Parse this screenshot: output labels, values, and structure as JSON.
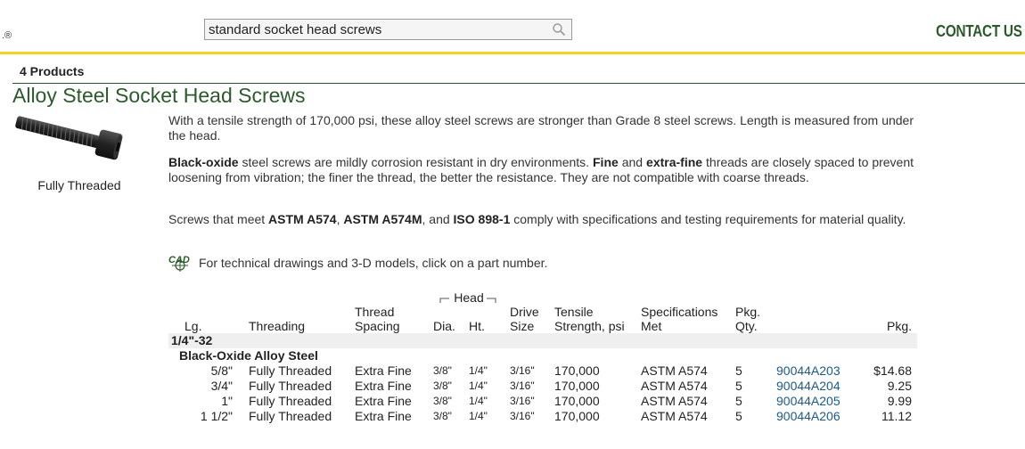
{
  "header": {
    "logo_mark": ".®",
    "search_value": "standard socket head screws",
    "contact_label": "CONTACT US"
  },
  "results": {
    "count": "4 Products",
    "title": "Alloy Steel Socket Head Screws",
    "thumb_label": "Fully Threaded",
    "para1": "With a tensile strength of 170,000 psi, these alloy steel screws are stronger than Grade 8 steel screws. Length is measured from under the head.",
    "para2": {
      "b1": "Black-oxide",
      "t1": " steel screws are mildly corrosion resistant in dry environments. ",
      "b2": "Fine",
      "t2": " and ",
      "b3": "extra-fine",
      "t3": " threads are closely spaced to prevent loosening from vibration; the finer the thread, the better the resistance. They are not compatible with coarse threads."
    },
    "para3": {
      "t1": "Screws that meet ",
      "b1": "ASTM A574",
      "t2": ", ",
      "b2": "ASTM A574M",
      "t3": ", and ",
      "b3": "ISO 898-1",
      "t4": " comply with specifications and testing requirements for material quality."
    },
    "cad_text": "For technical drawings and 3-D models, click on a part number."
  },
  "table": {
    "head_group": "Head",
    "columns": {
      "lg": "Lg.",
      "threading": "Threading",
      "spacing": "Thread Spacing",
      "dia": "Dia.",
      "ht": "Ht.",
      "drive": "Drive Size",
      "tensile": "Tensile Strength, psi",
      "spec": "Specifications Met",
      "qty": "Pkg. Qty.",
      "pkg": "Pkg."
    },
    "group": "1/4\"-32",
    "subgroup": "Black-Oxide Alloy Steel",
    "rows": [
      {
        "lg": "5/8\"",
        "threading": "Fully Threaded",
        "spacing": "Extra Fine",
        "dia": "3/8\"",
        "ht": "1/4\"",
        "drive": "3/16\"",
        "tensile": "170,000",
        "spec": "ASTM A574",
        "qty": "5",
        "part": "90044A203",
        "price": "$14.68"
      },
      {
        "lg": "3/4\"",
        "threading": "Fully Threaded",
        "spacing": "Extra Fine",
        "dia": "3/8\"",
        "ht": "1/4\"",
        "drive": "3/16\"",
        "tensile": "170,000",
        "spec": "ASTM A574",
        "qty": "5",
        "part": "90044A204",
        "price": "9.25"
      },
      {
        "lg": "1\"",
        "threading": "Fully Threaded",
        "spacing": "Extra Fine",
        "dia": "3/8\"",
        "ht": "1/4\"",
        "drive": "3/16\"",
        "tensile": "170,000",
        "spec": "ASTM A574",
        "qty": "5",
        "part": "90044A205",
        "price": "9.99"
      },
      {
        "lg": "1 1/2\"",
        "threading": "Fully Threaded",
        "spacing": "Extra Fine",
        "dia": "3/8\"",
        "ht": "1/4\"",
        "drive": "3/16\"",
        "tensile": "170,000",
        "spec": "ASTM A574",
        "qty": "5",
        "part": "90044A206",
        "price": "11.12"
      }
    ]
  },
  "colors": {
    "accent_green": "#2c5a2c",
    "header_rule": "#f4d21f",
    "link": "#1a5a8a"
  },
  "icons": {
    "search": "search-icon",
    "cad": "cad-icon",
    "product": "screw-image"
  }
}
